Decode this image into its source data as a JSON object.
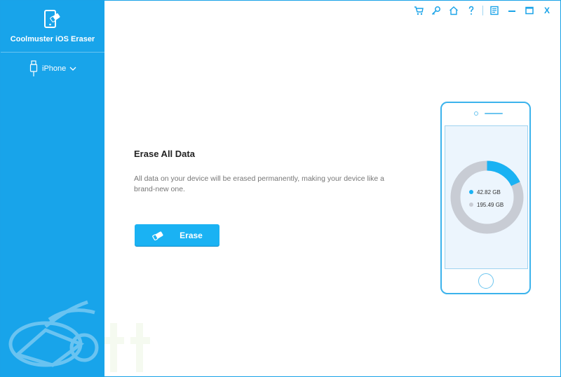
{
  "app": {
    "name": "Coolmuster iOS Eraser"
  },
  "device": {
    "selected": "iPhone"
  },
  "toolbar": {
    "icons": [
      "cart-icon",
      "key-icon",
      "home-icon",
      "help-icon",
      "feedback-icon",
      "minimize-icon",
      "maximize-icon",
      "close-icon"
    ],
    "close_label": "X"
  },
  "main": {
    "title": "Erase All Data",
    "description": "All data on your device will be erased permanently, making your device like a brand-new one.",
    "erase_label": "Erase"
  },
  "storage": {
    "used": {
      "label": "42.82 GB",
      "fraction": 0.18,
      "color": "#1ab2f3"
    },
    "free": {
      "label": "195.49 GB",
      "fraction": 0.82,
      "color": "#c8ccd4"
    }
  },
  "colors": {
    "accent": "#18a4ea",
    "button": "#1ab2f3"
  }
}
